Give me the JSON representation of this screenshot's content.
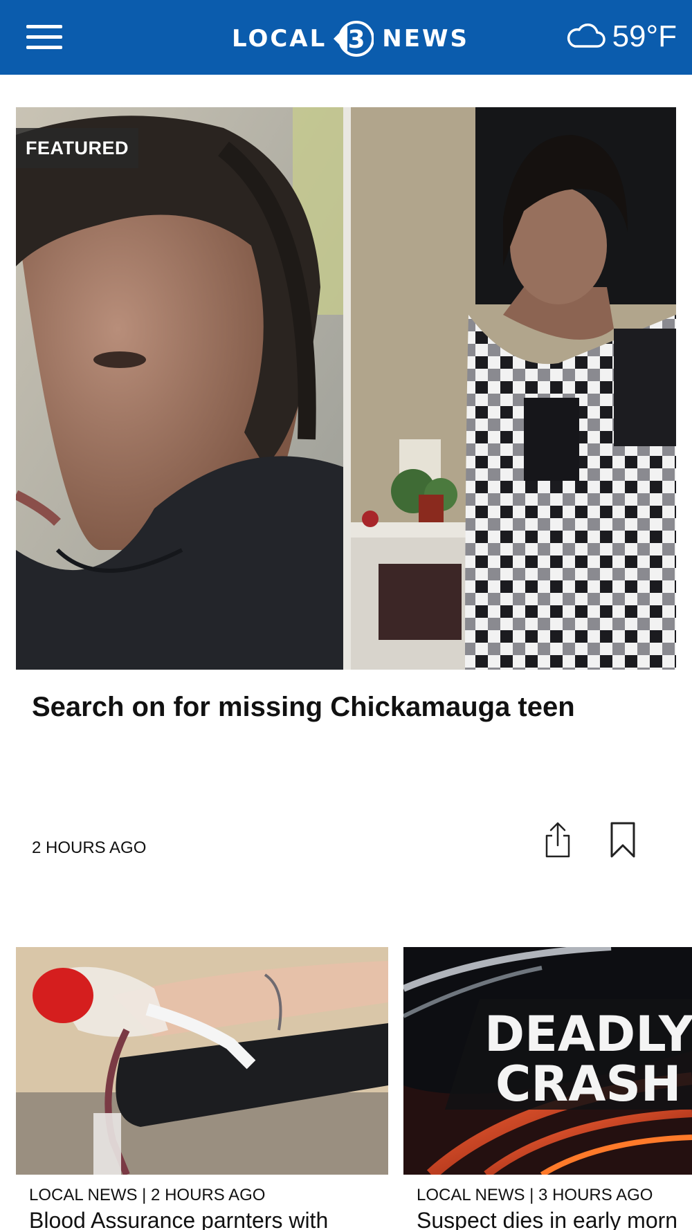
{
  "header": {
    "logo_left": "LOCAL",
    "logo_number": "3",
    "logo_right": "NEWS",
    "weather_icon": "cloud-icon",
    "temperature": "59°F"
  },
  "featured": {
    "badge": "FEATURED",
    "headline": "Search on for missing Chickamauga teen",
    "time": "2 HOURS AGO"
  },
  "cards": [
    {
      "kicker": "LOCAL NEWS | 2 HOURS AGO",
      "title": "Blood Assurance parnters with"
    },
    {
      "kicker": "LOCAL NEWS | 3 HOURS AGO",
      "title": "Suspect dies in early morn",
      "image_text_line1": "DEADLY",
      "image_text_line2": "CRASH"
    }
  ],
  "colors": {
    "header_bg": "#0b5cad",
    "text": "#111111"
  }
}
